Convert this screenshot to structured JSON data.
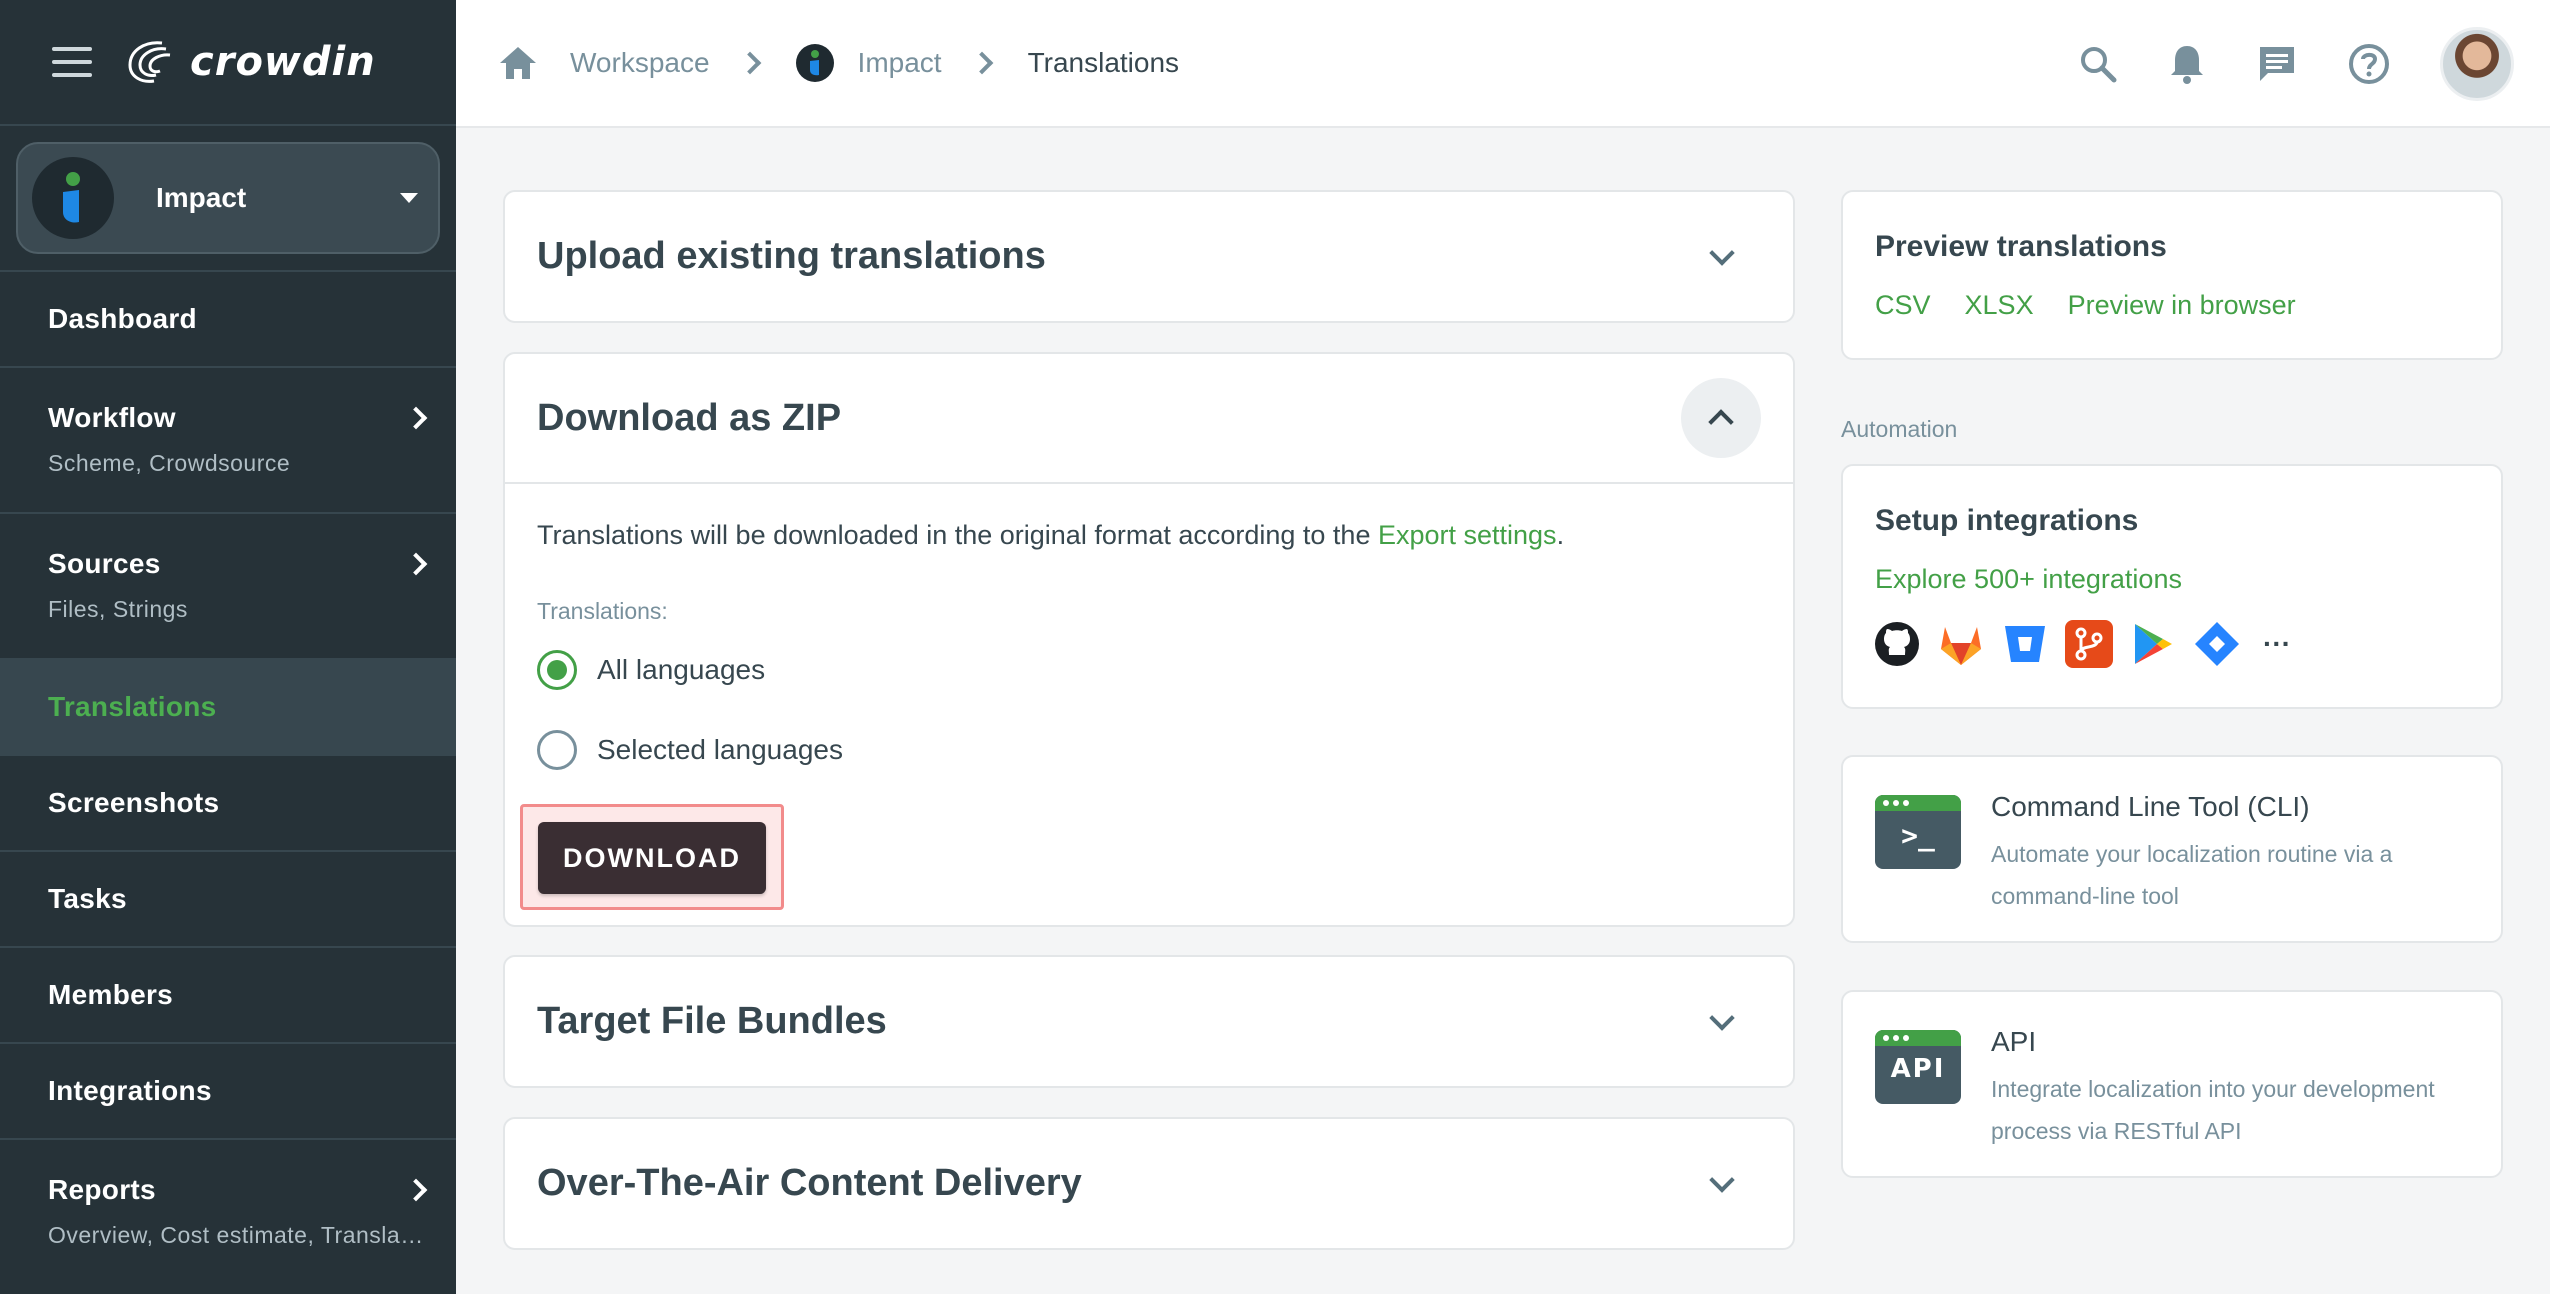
{
  "sidebar": {
    "logo_text": "crowdin",
    "project": {
      "name": "Impact"
    },
    "items": [
      {
        "label": "Dashboard"
      },
      {
        "label": "Workflow",
        "sub": "Scheme, Crowdsource"
      },
      {
        "label": "Sources",
        "sub": "Files, Strings"
      },
      {
        "label": "Translations",
        "active": true
      },
      {
        "label": "Screenshots"
      },
      {
        "label": "Tasks"
      },
      {
        "label": "Members"
      },
      {
        "label": "Integrations"
      },
      {
        "label": "Reports",
        "sub": "Overview, Cost estimate, Translation cost"
      }
    ]
  },
  "breadcrumb": {
    "home_icon": "home-icon",
    "workspace": "Workspace",
    "project": "Impact",
    "current": "Translations"
  },
  "header": {
    "icons": [
      "search-icon",
      "bell-icon",
      "chat-icon",
      "help-icon"
    ]
  },
  "upload": {
    "title": "Upload existing translations"
  },
  "download_zip": {
    "title": "Download as ZIP",
    "description_prefix": "Translations will be downloaded in the original format according to the ",
    "description_link": "Export settings",
    "description_suffix": ".",
    "field_label": "Translations:",
    "options": [
      "All languages",
      "Selected languages"
    ],
    "selected": "All languages",
    "button": "DOWNLOAD"
  },
  "bundles": {
    "title": "Target File Bundles"
  },
  "ota": {
    "title": "Over-The-Air Content Delivery"
  },
  "preview": {
    "title": "Preview translations",
    "links": [
      "CSV",
      "XLSX",
      "Preview in browser"
    ]
  },
  "automation": {
    "label": "Automation",
    "integrations_title": "Setup integrations",
    "integrations_link": "Explore 500+ integrations",
    "integration_icons": [
      "github-icon",
      "gitlab-icon",
      "bitbucket-icon",
      "git-icon",
      "google-play-icon",
      "jira-icon",
      "more-icon"
    ],
    "more": "···"
  },
  "cli": {
    "icon_text": ">_",
    "title": "Command Line Tool (CLI)",
    "description": "Automate your localization routine via a command-line tool"
  },
  "api": {
    "icon_text": "API",
    "title": "API",
    "description": "Integrate localization into your development process via RESTful API"
  },
  "colors": {
    "sidebar_bg": "#263238",
    "accent_green": "#43a047",
    "download_btn": "#3a2e33"
  }
}
